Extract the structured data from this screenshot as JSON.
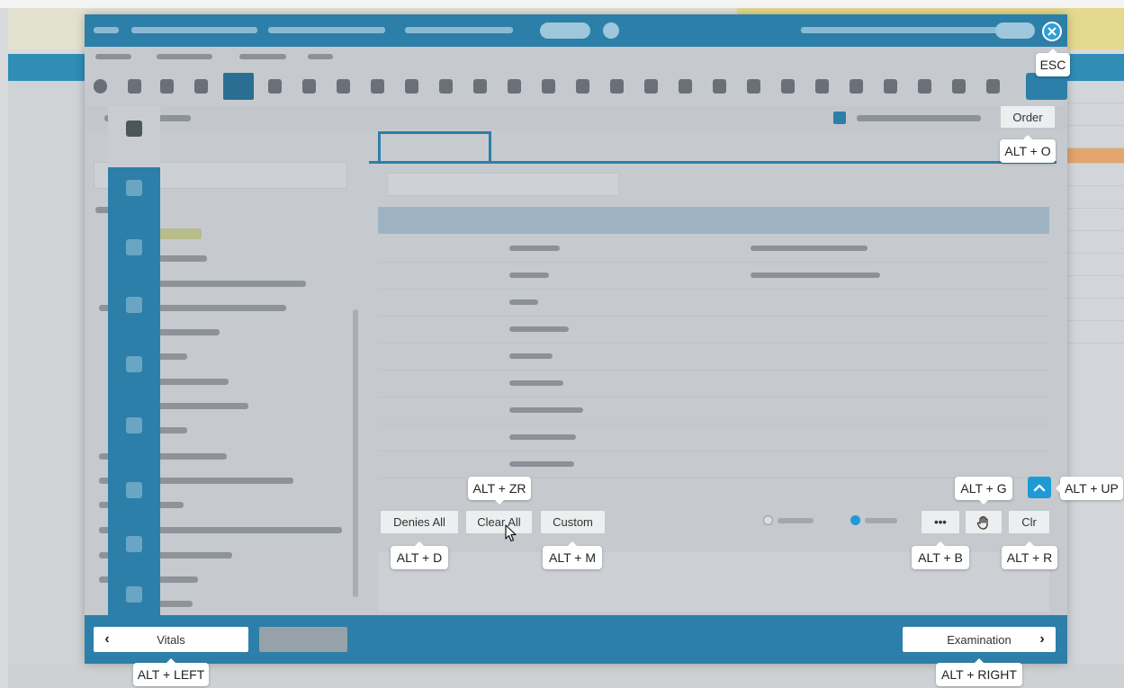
{
  "buttons": {
    "order": "Order",
    "denies_all": "Denies All",
    "clear_all": "Clear All",
    "custom": "Custom",
    "more": "•••",
    "clr": "Clr",
    "vitals": "Vitals",
    "examination": "Examination"
  },
  "shortcuts": {
    "esc": "ESC",
    "order": "ALT + O",
    "clear_all": "ALT + ZR",
    "denies_all": "ALT + D",
    "custom": "ALT + M",
    "more": "ALT + B",
    "gesture": "ALT + G",
    "clr": "ALT + R",
    "scroll_up": "ALT + UP",
    "vitals": "ALT + LEFT",
    "examination": "ALT + RIGHT"
  },
  "icons": {
    "close": "close-icon",
    "scroll_up": "chevron-up-icon",
    "prev": "chevron-left-icon",
    "next": "chevron-right-icon",
    "gesture": "hand-icon",
    "cursor": "mouse-cursor-icon"
  },
  "colors": {
    "accent": "#2c7fa8",
    "primary_button": "#1e9ad6"
  }
}
